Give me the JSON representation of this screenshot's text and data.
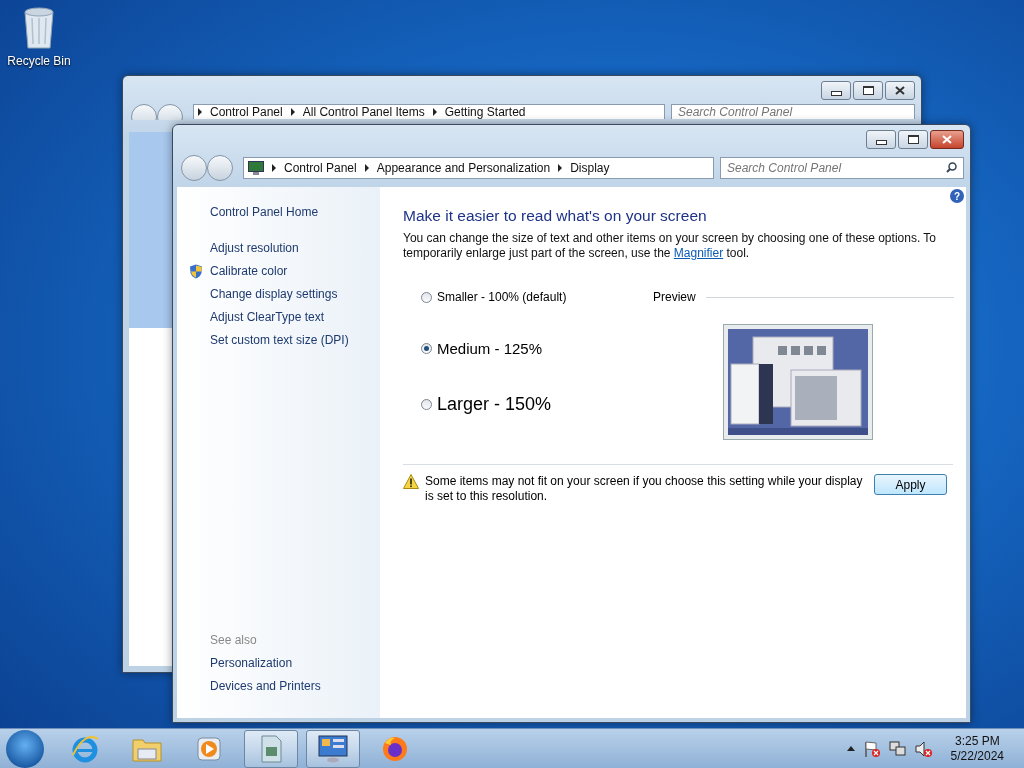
{
  "desktop_icons": [
    {
      "label": "Recycle Bin"
    }
  ],
  "back_window": {
    "breadcrumb": [
      "Control Panel",
      "All Control Panel Items",
      "Getting Started"
    ],
    "search": {
      "placeholder": "Search Control Panel"
    }
  },
  "window": {
    "breadcrumb": [
      "Control Panel",
      "Appearance and Personalization",
      "Display"
    ],
    "search": {
      "placeholder": "Search Control Panel"
    },
    "help": "?"
  },
  "sidebar": {
    "home": "Control Panel Home",
    "tasks": [
      {
        "label": "Adjust resolution",
        "shield": false
      },
      {
        "label": "Calibrate color",
        "shield": true
      },
      {
        "label": "Change display settings",
        "shield": false
      },
      {
        "label": "Adjust ClearType text",
        "shield": false
      },
      {
        "label": "Set custom text size (DPI)",
        "shield": false
      }
    ],
    "see_also": {
      "title": "See also",
      "links": [
        "Personalization",
        "Devices and Printers"
      ]
    }
  },
  "content": {
    "heading": "Make it easier to read what's on your screen",
    "description": {
      "before": "You can change the size of text and other items on your screen by choosing one of these options. To temporarily enlarge just part of the screen, use the",
      "link": "Magnifier",
      "after": "tool."
    },
    "options": [
      {
        "label": "Smaller - 100% (default)",
        "kind": "small",
        "selected": false
      },
      {
        "label": "Medium - 125%",
        "kind": "medium",
        "selected": true
      },
      {
        "label": "Larger - 150%",
        "kind": "large",
        "selected": false
      }
    ],
    "preview_label": "Preview",
    "warning": "Some items may not fit on your screen if you choose this setting while your display is set to this resolution.",
    "apply_button": "Apply"
  },
  "taskbar": {
    "apps": [
      {
        "kind": "ie",
        "open": false
      },
      {
        "kind": "explorer",
        "open": false
      },
      {
        "kind": "media",
        "open": false
      },
      {
        "kind": "document",
        "open": true
      },
      {
        "kind": "controlpanel",
        "open": true
      },
      {
        "kind": "firefox",
        "open": false
      }
    ],
    "time": "3:25 PM",
    "date": "5/22/2024"
  }
}
